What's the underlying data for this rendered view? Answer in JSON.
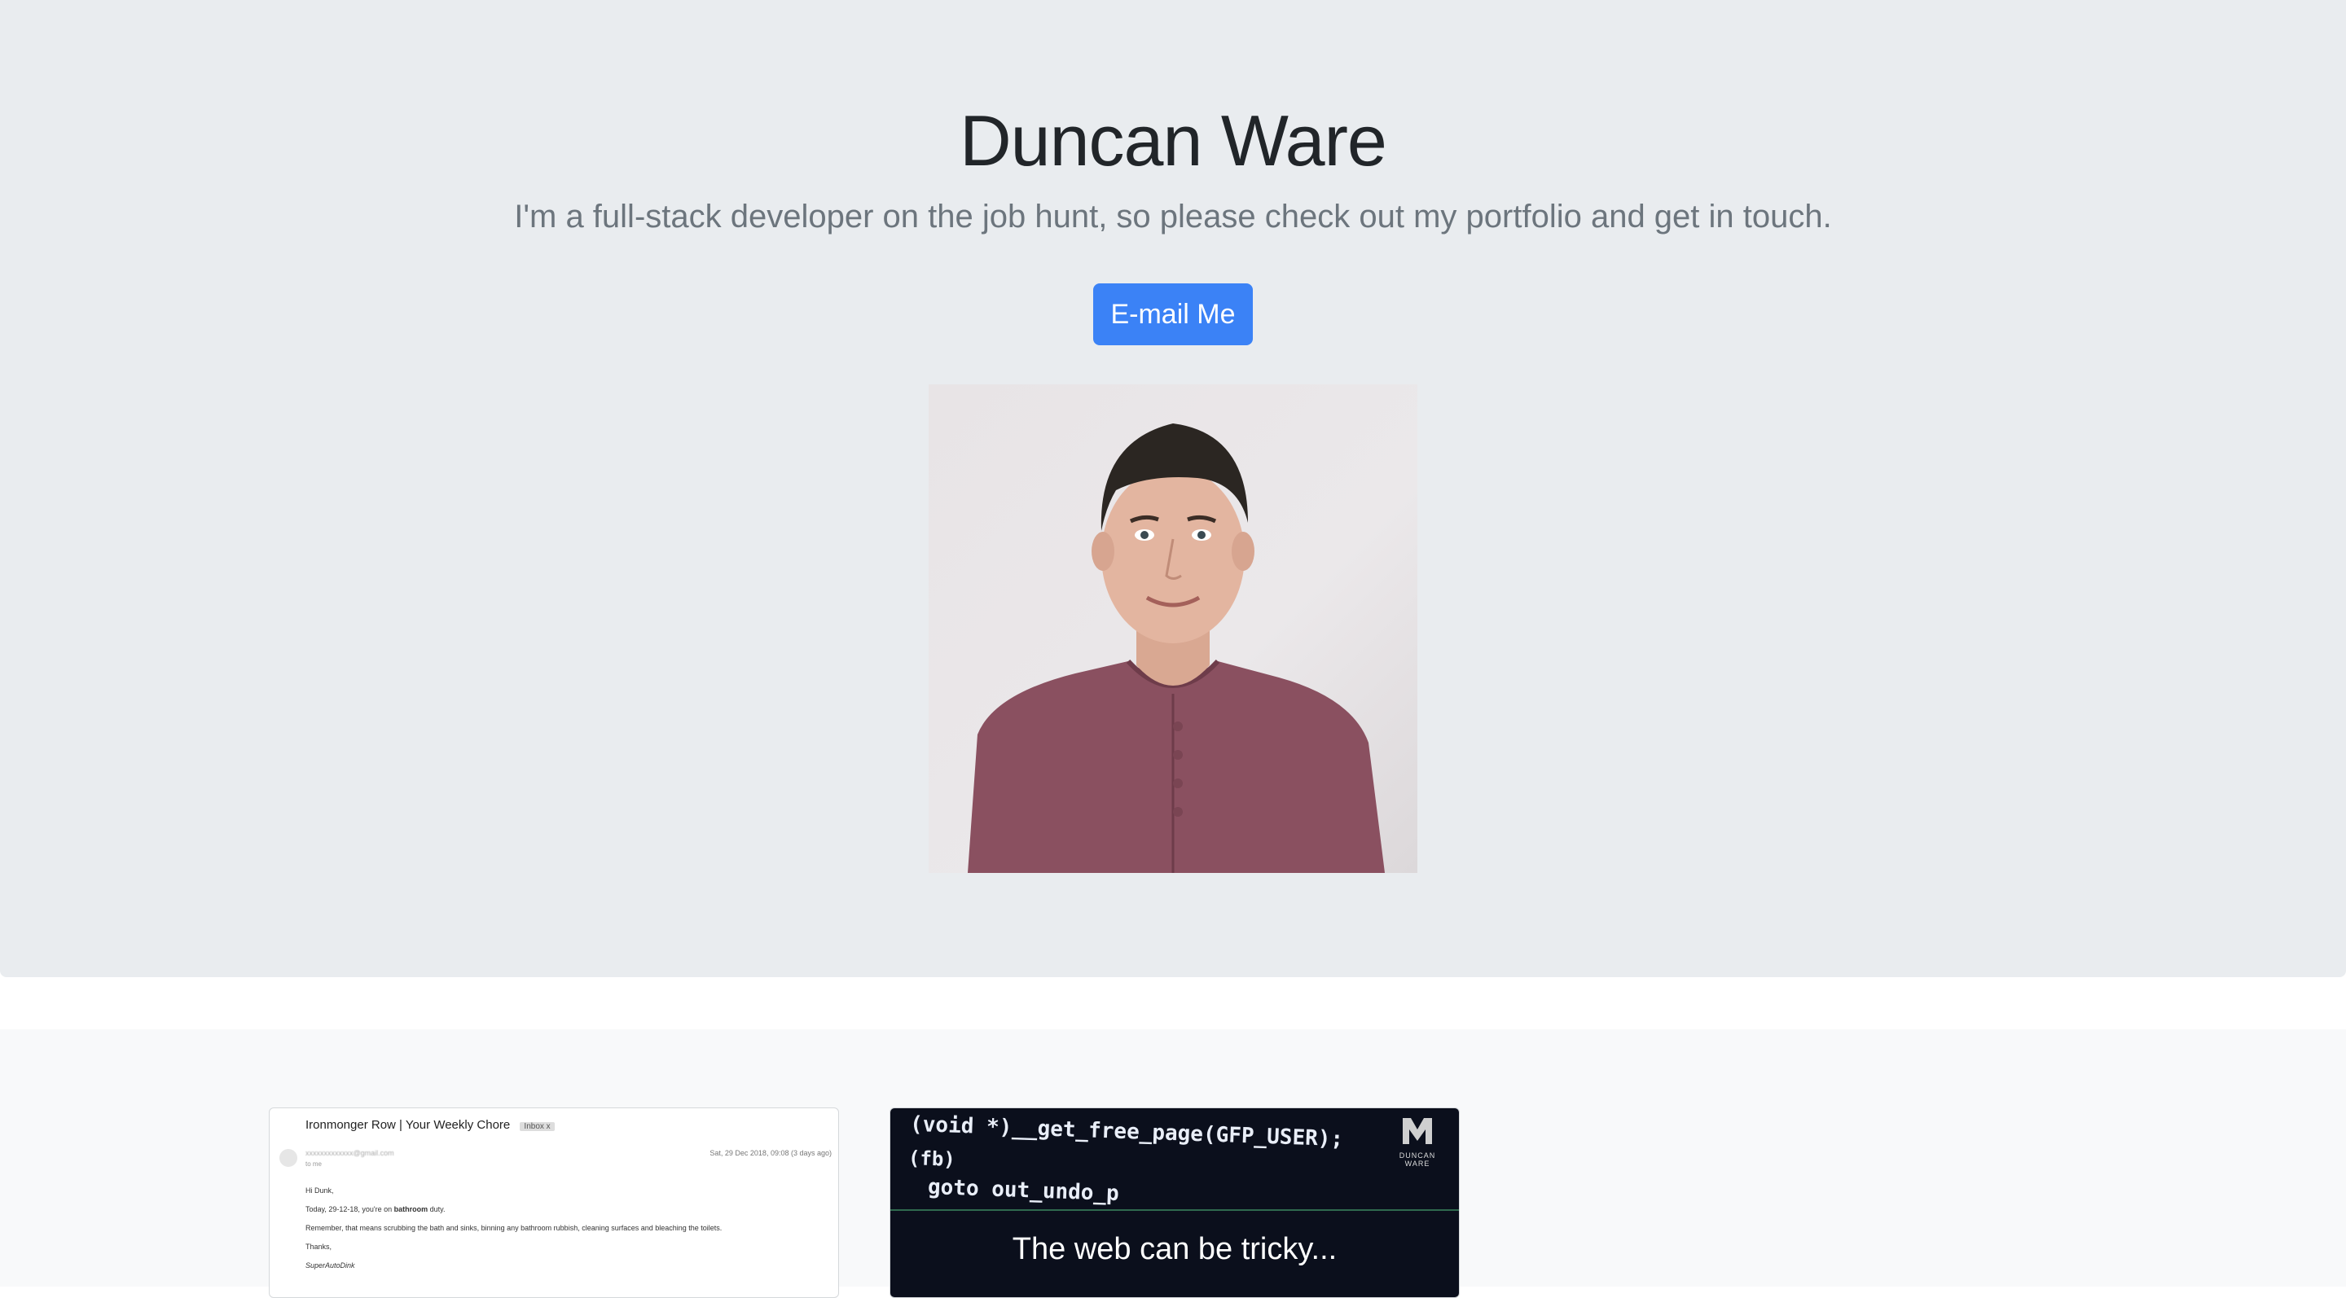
{
  "hero": {
    "name": "Duncan Ware",
    "tagline": "I'm a full-stack developer on the job hunt, so please check out my portfolio and get in touch.",
    "email_button": "E-mail Me",
    "accent_color": "#3b82f6",
    "background_color": "#e9ecef"
  },
  "portfolio": {
    "cards": [
      {
        "type": "email-screenshot",
        "subject": "Ironmonger Row | Your Weekly Chore",
        "tag": "Inbox x",
        "from": "xxxxxxxxxxxxx@gmail.com",
        "to": "to me",
        "date": "Sat, 29 Dec 2018, 09:08 (3 days ago)",
        "body": {
          "greeting": "Hi Dunk,",
          "line1_prefix": "Today, 29-12-18, you're on ",
          "line1_bold": "bathroom",
          "line1_suffix": " duty.",
          "line2": "Remember, that means scrubbing the bath and sinks, binning any bathroom rubbish, cleaning surfaces and bleaching the toilets.",
          "thanks": "Thanks,",
          "signature": "SuperAutoDink"
        }
      },
      {
        "type": "video-thumbnail",
        "code_lines": [
          "(void *)__get_free_page(GFP_USER);",
          "(fb)",
          "goto out_undo_p"
        ],
        "brand": "DUNCAN WARE",
        "caption": "The web can be tricky..."
      }
    ]
  }
}
